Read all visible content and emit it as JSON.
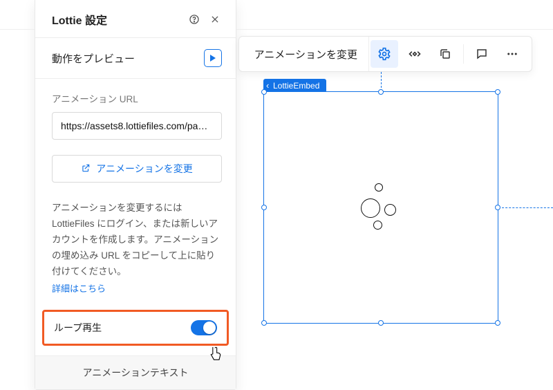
{
  "panel": {
    "title": "Lottie 設定",
    "preview_label": "動作をプレビュー",
    "url_label": "アニメーション URL",
    "url_value": "https://assets8.lottiefiles.com/pa…",
    "change_button": "アニメーションを変更",
    "help_text": "アニメーションを変更するには LottieFiles にログイン、または新しいアカウントを作成します。アニメーションの埋め込み URL をコピーして上に貼り付けてください。",
    "help_link": "詳細はこちら",
    "loop_label": "ループ再生",
    "loop_on": true,
    "bottom_tab": "アニメーションテキスト"
  },
  "toolbar": {
    "change_label": "アニメーションを変更"
  },
  "canvas": {
    "element_tag": "LottieEmbed"
  }
}
